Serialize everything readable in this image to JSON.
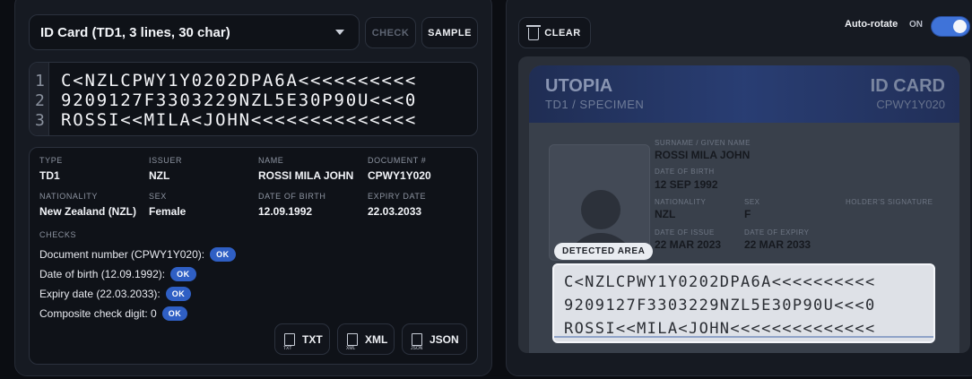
{
  "toolbar": {
    "doc_type": "ID Card (TD1, 3 lines, 30 char)",
    "check_label": "CHECK",
    "sample_label": "SAMPLE"
  },
  "mrz": {
    "line_numbers": [
      "1",
      "2",
      "3"
    ],
    "lines": [
      "C<NZLCPWY1Y0202DPA6A<<<<<<<<<<",
      "9209127F3303229NZL5E30P90U<<<0",
      "ROSSI<<MILA<JOHN<<<<<<<<<<<<<<"
    ]
  },
  "result": {
    "fields": [
      {
        "label": "TYPE",
        "value": "TD1"
      },
      {
        "label": "ISSUER",
        "value": "NZL"
      },
      {
        "label": "NAME",
        "value": "ROSSI MILA JOHN"
      },
      {
        "label": "DOCUMENT #",
        "value": "CPWY1Y020"
      },
      {
        "label": "NATIONALITY",
        "value": "New Zealand (NZL)"
      },
      {
        "label": "SEX",
        "value": "Female"
      },
      {
        "label": "DATE OF BIRTH",
        "value": "12.09.1992"
      },
      {
        "label": "EXPIRY DATE",
        "value": "22.03.2033"
      }
    ],
    "checks_title": "CHECKS",
    "checks": [
      {
        "text": "Document number (CPWY1Y020):",
        "status": "OK"
      },
      {
        "text": "Date of birth (12.09.1992):",
        "status": "OK"
      },
      {
        "text": "Expiry date (22.03.2033):",
        "status": "OK"
      },
      {
        "text": "Composite check digit: 0",
        "status": "OK"
      }
    ],
    "exports": [
      {
        "format": "TXT",
        "icon_text": "TXT"
      },
      {
        "format": "XML",
        "icon_text": "XML"
      },
      {
        "format": "JSON",
        "icon_text": "JSON"
      }
    ]
  },
  "viewer": {
    "clear_label": "CLEAR",
    "auto_rotate_label": "Auto-rotate",
    "auto_rotate_state": "ON",
    "detected_label": "DETECTED AREA",
    "card": {
      "country": "UTOPIA",
      "subtitle": "TD1 / SPECIMEN",
      "doc_title": "ID CARD",
      "doc_number": "CPWY1Y020",
      "name_label": "SURNAME / GIVEN NAME",
      "name_value": "ROSSI MILA JOHN",
      "dob_label": "DATE OF BIRTH",
      "dob_value": "12 SEP 1992",
      "nationality_label": "NATIONALITY",
      "nationality_value": "NZL",
      "sex_label": "SEX",
      "sex_value": "F",
      "signature_label": "HOLDER'S SIGNATURE",
      "issue_label": "DATE OF ISSUE",
      "issue_value": "22 MAR 2023",
      "expiry_label": "DATE OF EXPIRY",
      "expiry_value": "22 MAR 2033"
    }
  },
  "colors": {
    "accent": "#3f73d9",
    "ok_badge": "#2f5fc4",
    "panel": "#161a22",
    "background": "#0b0d12"
  }
}
